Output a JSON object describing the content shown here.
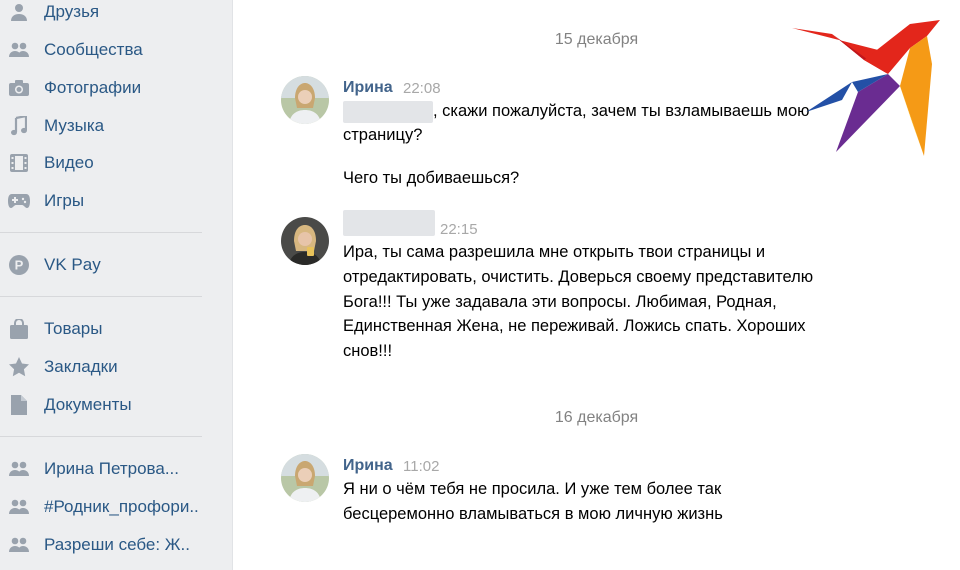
{
  "sidebar": {
    "items": [
      {
        "label": "Друзья",
        "icon": "user-icon"
      },
      {
        "label": "Сообщества",
        "icon": "users-icon"
      },
      {
        "label": "Фотографии",
        "icon": "camera-icon"
      },
      {
        "label": "Музыка",
        "icon": "music-note-icon"
      },
      {
        "label": "Видео",
        "icon": "film-icon"
      },
      {
        "label": "Игры",
        "icon": "gamepad-icon"
      },
      {
        "label": "VK Pay",
        "icon": "vkpay-icon"
      },
      {
        "label": "Товары",
        "icon": "shopping-bag-icon"
      },
      {
        "label": "Закладки",
        "icon": "star-icon"
      },
      {
        "label": "Документы",
        "icon": "document-icon"
      },
      {
        "label": "Ирина Петрова...",
        "icon": "users-icon"
      },
      {
        "label": "#Родник_профори..",
        "icon": "users-icon"
      },
      {
        "label": "Разреши себе: Ж..",
        "icon": "users-icon"
      }
    ]
  },
  "chat": {
    "dates": [
      "15 декабря",
      "16 декабря"
    ],
    "messages": [
      {
        "author": "Ирина",
        "time": "22:08",
        "lines": [
          ", скажи пожалуйста, зачем ты взламываешь мою",
          "страницу?",
          "Чего ты добиваешься?"
        ]
      },
      {
        "author": "",
        "time": "22:15",
        "lines": [
          "Ира, ты сама разрешила мне открыть твои страницы и",
          "отредактировать, очистить. Доверься своему представителю",
          "Бога!!! Ты уже задавала эти вопросы. Любимая, Родная,",
          "Единственная Жена, не переживай. Ложись спать. Хороших",
          "снов!!!"
        ]
      },
      {
        "author": "Ирина",
        "time": "11:02",
        "lines": [
          "Я ни о чём тебя не просила. И уже тем более так",
          "бесцеремонно вламываться в мою личную жизнь"
        ]
      }
    ]
  },
  "colors": {
    "link": "#2a5885",
    "author": "#42648b",
    "muted": "#828282",
    "icon": "#99a2ad",
    "logo_red": "#e3261b",
    "logo_orange": "#f59a16",
    "logo_yellow": "#fbc21b",
    "logo_purple": "#6a2c91"
  }
}
